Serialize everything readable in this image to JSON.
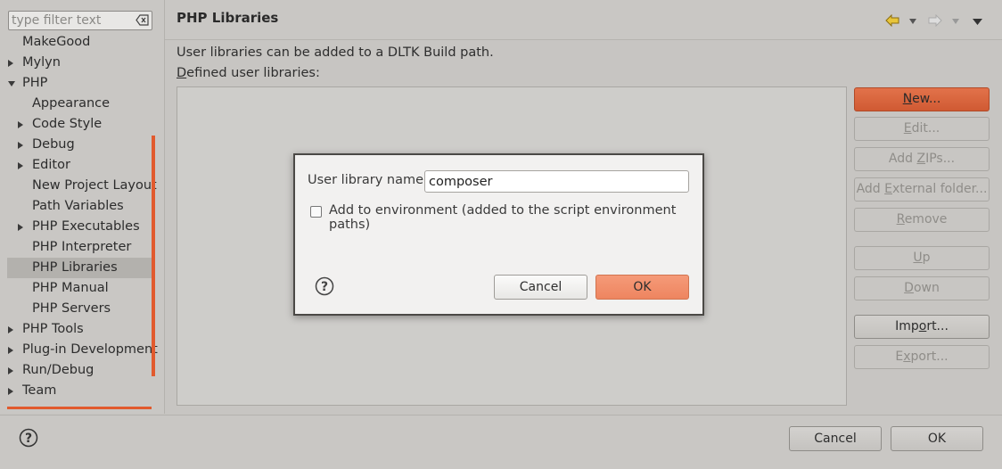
{
  "filter": {
    "placeholder": "type filter text"
  },
  "tree": [
    {
      "label": "MakeGood",
      "indent": 0,
      "arrow": "none"
    },
    {
      "label": "Mylyn",
      "indent": 0,
      "arrow": "right"
    },
    {
      "label": "PHP",
      "indent": 0,
      "arrow": "down"
    },
    {
      "label": "Appearance",
      "indent": 1,
      "arrow": "none"
    },
    {
      "label": "Code Style",
      "indent": 1,
      "arrow": "right"
    },
    {
      "label": "Debug",
      "indent": 1,
      "arrow": "right"
    },
    {
      "label": "Editor",
      "indent": 1,
      "arrow": "right"
    },
    {
      "label": "New Project Layout",
      "indent": 1,
      "arrow": "none"
    },
    {
      "label": "Path Variables",
      "indent": 1,
      "arrow": "none"
    },
    {
      "label": "PHP Executables",
      "indent": 1,
      "arrow": "right"
    },
    {
      "label": "PHP Interpreter",
      "indent": 1,
      "arrow": "none"
    },
    {
      "label": "PHP Libraries",
      "indent": 1,
      "arrow": "none",
      "selected": true
    },
    {
      "label": "PHP Manual",
      "indent": 1,
      "arrow": "none"
    },
    {
      "label": "PHP Servers",
      "indent": 1,
      "arrow": "none"
    },
    {
      "label": "PHP Tools",
      "indent": 0,
      "arrow": "right"
    },
    {
      "label": "Plug-in Development",
      "indent": 0,
      "arrow": "right"
    },
    {
      "label": "Run/Debug",
      "indent": 0,
      "arrow": "right"
    },
    {
      "label": "Team",
      "indent": 0,
      "arrow": "right"
    }
  ],
  "page": {
    "title": "PHP Libraries",
    "description": "User libraries can be added to a DLTK Build path.",
    "defined_label": "Defined user libraries:"
  },
  "buttons": {
    "new": "New...",
    "edit": "Edit...",
    "add_zips": "Add ZIPs...",
    "add_external_folder": "Add External folder...",
    "remove": "Remove",
    "up": "Up",
    "down": "Down",
    "import": "Import...",
    "export": "Export..."
  },
  "footer": {
    "cancel": "Cancel",
    "ok": "OK"
  },
  "dialog": {
    "name_label": "User library name:",
    "name_value": "composer",
    "add_env_label": "Add to environment (added to the script environment paths)",
    "add_env_checked": false,
    "cancel": "Cancel",
    "ok": "OK"
  },
  "colors": {
    "accent": "#e15a2e",
    "ok_button": "#ee8560"
  }
}
